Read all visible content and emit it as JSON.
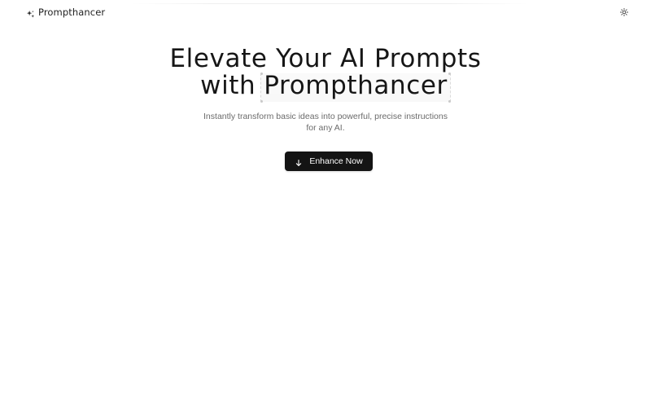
{
  "header": {
    "brand_name": "Prompthancer",
    "brand_icon": "sparkles-icon",
    "theme_toggle_icon": "sun-icon"
  },
  "hero": {
    "headline_line1": "Elevate Your AI Prompts",
    "headline_with": "with",
    "headline_highlight": "Prompthancer",
    "subtitle": "Instantly transform basic ideas into powerful, precise instructions for any AI."
  },
  "cta": {
    "label": "Enhance Now",
    "icon": "arrow-down-icon"
  },
  "colors": {
    "background": "#ffffff",
    "text": "#161616",
    "muted_text": "#6b6b6b",
    "button_bg": "#141414",
    "button_text": "#ffffff"
  }
}
